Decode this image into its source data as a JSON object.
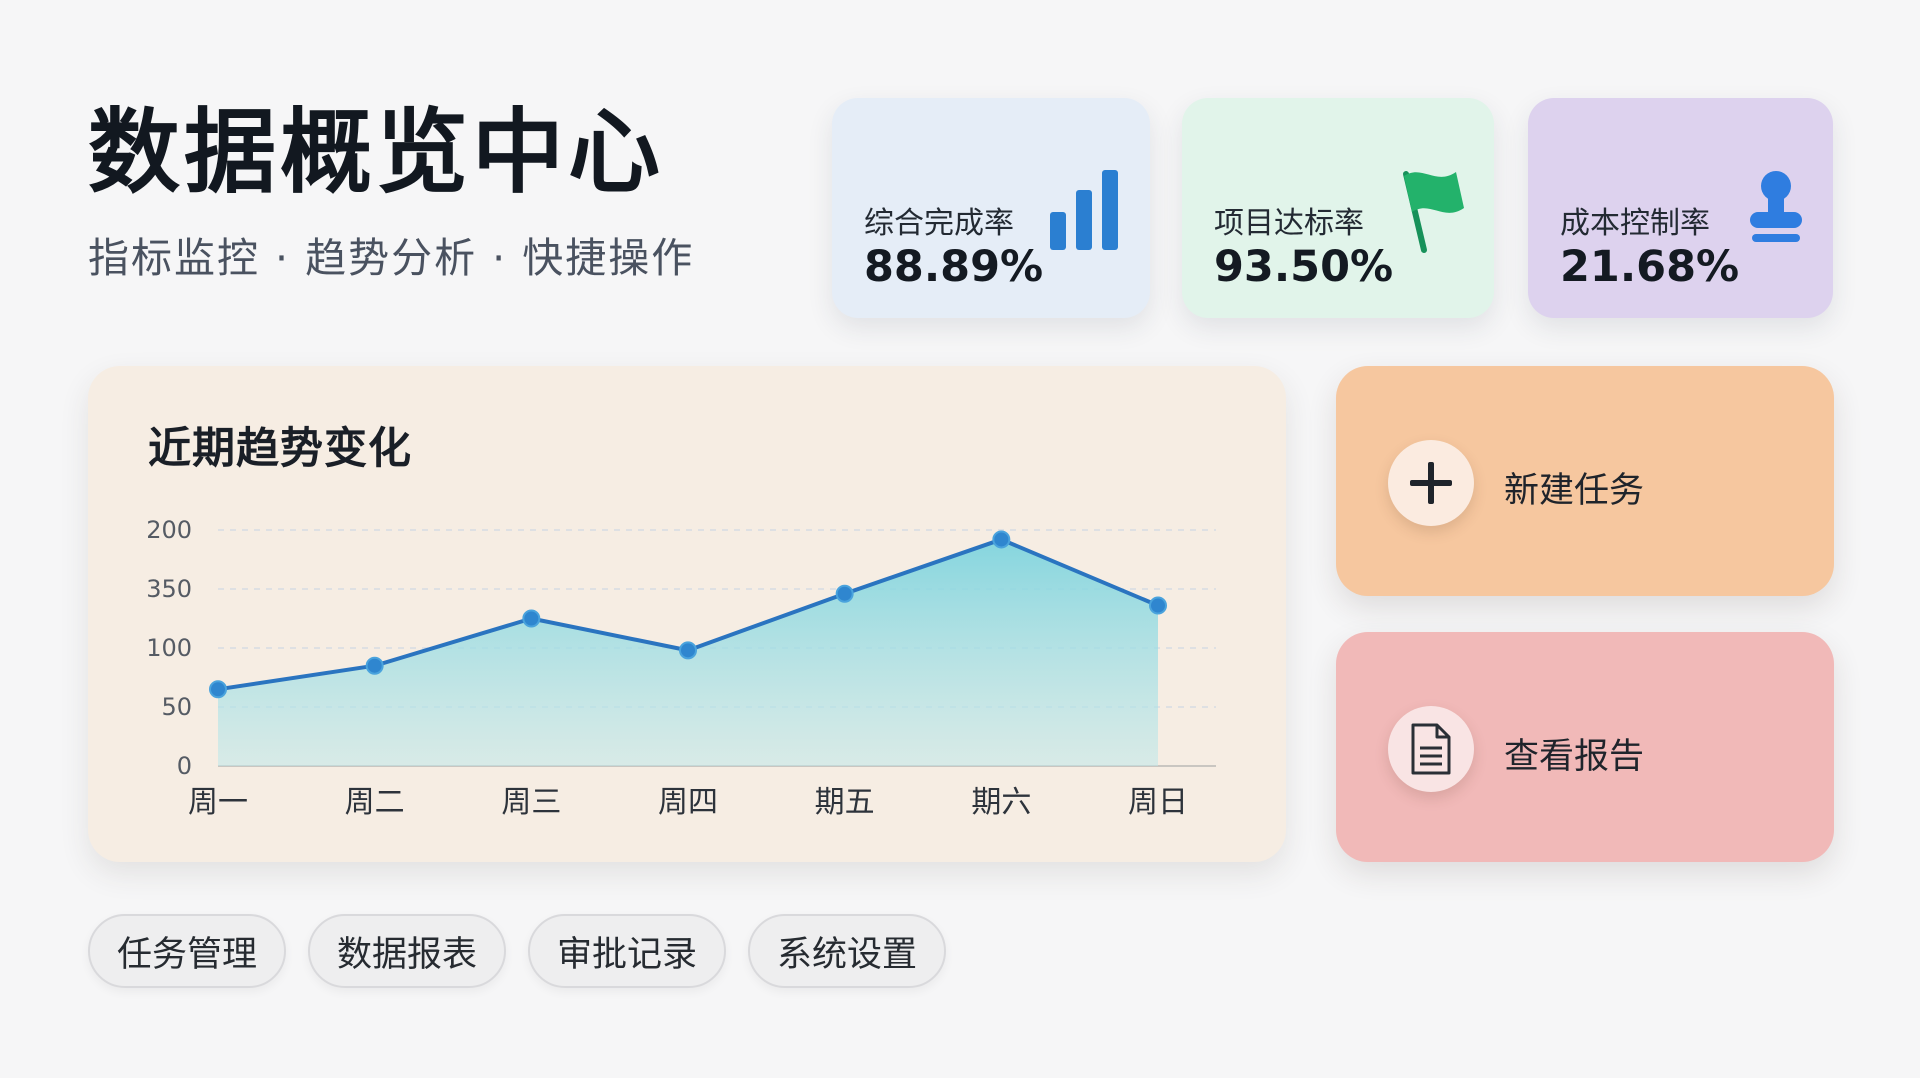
{
  "header": {
    "title": "数据概览中心",
    "subtitle": "指标监控 · 趋势分析 · 快捷操作"
  },
  "kpis": [
    {
      "label": "综合完成率",
      "value": "88.89%",
      "icon": "bar-chart-icon",
      "color": "#2b7fd1"
    },
    {
      "label": "项目达标率",
      "value": "93.50%",
      "icon": "flag-icon",
      "color": "#1fa862"
    },
    {
      "label": "成本控制率",
      "value": "21.68%",
      "icon": "stamp-icon",
      "color": "#2f7de0"
    }
  ],
  "trend": {
    "title": "近期趋势变化"
  },
  "chart_data": {
    "type": "area",
    "title": "近期趋势变化",
    "categories": [
      "周一",
      "周二",
      "周三",
      "周四",
      "期五",
      "期六",
      "周日"
    ],
    "values": [
      65,
      85,
      125,
      98,
      146,
      192,
      136
    ],
    "y_tick_labels": [
      "0",
      "50",
      "100",
      "350",
      "200"
    ],
    "y_tick_values": [
      0,
      50,
      100,
      150,
      200
    ],
    "ylim": [
      0,
      200
    ],
    "grid": true,
    "line_color": "#2a74c0",
    "fill_color": "#7fd4de"
  },
  "actions": [
    {
      "label": "新建任务",
      "icon": "plus-icon"
    },
    {
      "label": "查看报告",
      "icon": "document-icon"
    }
  ],
  "nav": [
    "任务管理",
    "数据报表",
    "审批记录",
    "系统设置"
  ]
}
